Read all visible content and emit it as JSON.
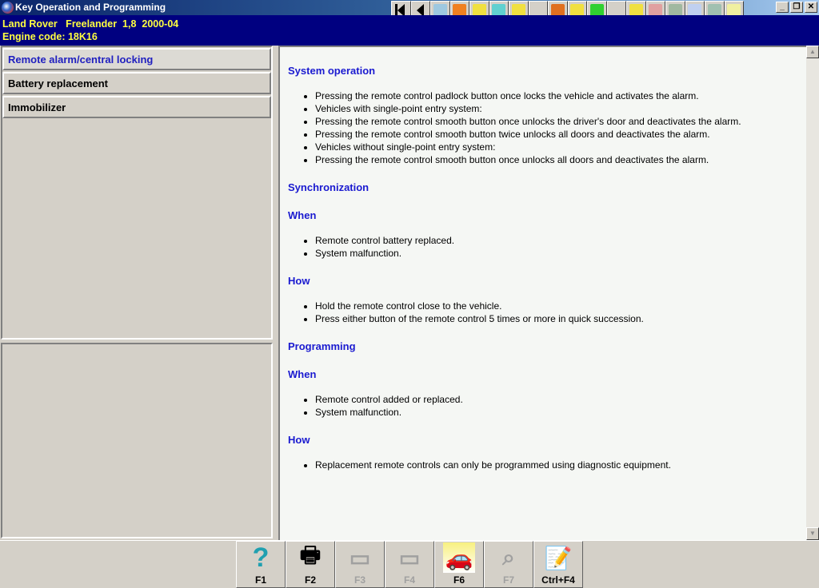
{
  "window": {
    "title": "Key Operation and Programming"
  },
  "header": {
    "vehicle": "Land Rover   Freelander  1,8  2000-04",
    "engine": "Engine code: 18K16"
  },
  "toolbar": [
    {
      "icon": "first-icon",
      "color": "#d4d0c8"
    },
    {
      "icon": "previous-icon",
      "color": "#d4d0c8"
    },
    {
      "icon": "tools-icon",
      "color": "#9ec8e0"
    },
    {
      "icon": "engine-icon",
      "color": "#f08020"
    },
    {
      "icon": "ignition-icon",
      "color": "#f0e040"
    },
    {
      "icon": "electrical-icon",
      "color": "#60d0d0"
    },
    {
      "icon": "battery-icon",
      "color": "#f0e040"
    },
    {
      "icon": "service-icon",
      "color": "#d4d0c8"
    },
    {
      "icon": "key-icon",
      "color": "#e07020"
    },
    {
      "icon": "alarm-icon",
      "color": "#f0e040"
    },
    {
      "icon": "printer-icon",
      "color": "#30d030"
    },
    {
      "icon": "wiring-icon",
      "color": "#d4d0c8"
    },
    {
      "icon": "help-car-icon",
      "color": "#f0e040"
    },
    {
      "icon": "srs-icon",
      "color": "#e0a0a0"
    },
    {
      "icon": "climate-icon",
      "color": "#a0b8a0"
    },
    {
      "icon": "abs-icon",
      "color": "#c0d0f0"
    },
    {
      "icon": "parts-icon",
      "color": "#a0c0b0"
    },
    {
      "icon": "info-icon",
      "color": "#f0f0a0"
    }
  ],
  "window_buttons": {
    "minimize": "_",
    "restore": "❐",
    "close": "✕"
  },
  "nav": [
    {
      "label": "Remote alarm/central locking",
      "active": true
    },
    {
      "label": "Battery replacement",
      "active": false
    },
    {
      "label": "Immobilizer",
      "active": false
    }
  ],
  "content": {
    "sections": [
      {
        "heading": "System operation",
        "items": [
          "Pressing the remote control padlock button once locks the vehicle and activates the alarm.",
          "Vehicles with single-point entry system:",
          "Pressing the remote control smooth button once unlocks the driver's door and deactivates the alarm.",
          "Pressing the remote control smooth button twice unlocks all doors and deactivates the alarm.",
          "Vehicles without single-point entry system:",
          "Pressing the remote control smooth button once unlocks all doors and deactivates the alarm."
        ]
      },
      {
        "heading": "Synchronization",
        "items": []
      },
      {
        "heading": "When",
        "items": [
          "Remote control battery replaced.",
          "System malfunction."
        ]
      },
      {
        "heading": "How",
        "items": [
          "Hold the remote control close to the vehicle.",
          "Press either button of the remote control 5 times or more in quick succession."
        ]
      },
      {
        "heading": "Programming",
        "items": []
      },
      {
        "heading": "When",
        "items": [
          "Remote control added or replaced.",
          "System malfunction."
        ]
      },
      {
        "heading": "How",
        "items": [
          "Replacement remote controls can only be programmed using diagnostic equipment."
        ]
      }
    ]
  },
  "fkeys": [
    {
      "label": "F1",
      "icon": "help-icon",
      "glyph": "?",
      "enabled": true
    },
    {
      "label": "F2",
      "icon": "printer-icon",
      "glyph": "🖶",
      "enabled": true
    },
    {
      "label": "F3",
      "icon": "picture-icon",
      "glyph": "▭",
      "enabled": false
    },
    {
      "label": "F4",
      "icon": "picture-icon",
      "glyph": "▭",
      "enabled": false
    },
    {
      "label": "F6",
      "icon": "car-service-icon",
      "glyph": "🚗",
      "enabled": true
    },
    {
      "label": "F7",
      "icon": "magnifier-icon",
      "glyph": "⌕",
      "enabled": false
    },
    {
      "label": "Ctrl+F4",
      "icon": "notes-icon",
      "glyph": "📝",
      "enabled": true
    }
  ]
}
